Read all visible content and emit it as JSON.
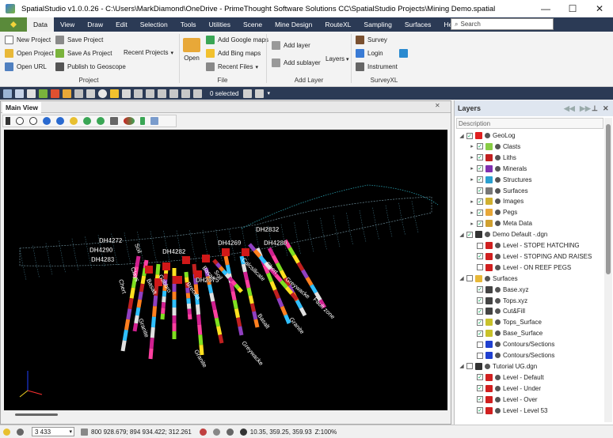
{
  "window": {
    "title": "SpatialStudio v1.0.0.26 - C:\\Users\\MarkDiamond\\OneDrive - PrimeThought Software Solutions CC\\SpatialStudio Projects\\Mining Demo.spatial",
    "minimize": "—",
    "maximize": "☐",
    "close": "✕"
  },
  "menu": {
    "items": [
      "Data",
      "View",
      "Draw",
      "Edit",
      "Selection",
      "Tools",
      "Utilities",
      "Scene",
      "Mine Design",
      "RouteXL",
      "Sampling",
      "Surfaces",
      "Help"
    ],
    "search_placeholder": "Search"
  },
  "ribbon": {
    "new_project": "New Project",
    "open_project": "Open Project",
    "open_url": "Open URL",
    "save_project": "Save Project",
    "save_as_project": "Save As Project",
    "publish_geoscope": "Publish to Geoscope",
    "recent_projects": "Recent Projects",
    "project_group": "Project",
    "open": "Open",
    "add_google_maps": "Add Google maps",
    "add_bing_maps": "Add Bing maps",
    "recent_files": "Recent Files",
    "file_group": "File",
    "add_layer": "Add layer",
    "add_sublayer": "Add sublayer",
    "layers": "Layers",
    "add_layer_group": "Add Layer",
    "survey": "Survey",
    "login": "Login",
    "instrument": "Instrument",
    "surveyxl_group": "SurveyXL"
  },
  "toolbar": {
    "selected": "0 selected"
  },
  "main_view": {
    "tab": "Main View",
    "drillhole_labels": [
      "DH4272",
      "DH4290",
      "DH4283",
      "DH4282",
      "DH4269",
      "DH4280",
      "DH2832",
      "DH2675"
    ],
    "lith_labels": [
      "Soil",
      "Clays",
      "Basalt",
      "Gabbro",
      "Chert",
      "Granite",
      "Breccia",
      "Basalt",
      "Soil",
      "Calcsilicate",
      "Greywacke",
      "Fault zone",
      "Granite",
      "Chert",
      "Basalt",
      "Greywacke",
      "Granite"
    ]
  },
  "layers": {
    "title": "Layers",
    "description_header": "Description",
    "rows": [
      {
        "label": "GeoLog",
        "level": 0,
        "checked": true,
        "expander": "◢",
        "color": "#e02020"
      },
      {
        "label": "Clasts",
        "level": 1,
        "checked": true,
        "expander": "▸",
        "color": "#88cc44"
      },
      {
        "label": "Liths",
        "level": 1,
        "checked": true,
        "expander": "▸",
        "color": "#c02020"
      },
      {
        "label": "Minerals",
        "level": 1,
        "checked": true,
        "expander": "▸",
        "color": "#8030b0"
      },
      {
        "label": "Structures",
        "level": 1,
        "checked": true,
        "expander": "▸",
        "color": "#2aa0d0"
      },
      {
        "label": "Surfaces",
        "level": 1,
        "checked": true,
        "expander": "",
        "color": "#777777"
      },
      {
        "label": "Images",
        "level": 1,
        "checked": true,
        "expander": "▸",
        "color": "#d0b030"
      },
      {
        "label": "Pegs",
        "level": 1,
        "checked": true,
        "expander": "▸",
        "color": "#e8a838"
      },
      {
        "label": "Meta Data",
        "level": 1,
        "checked": true,
        "expander": "▸",
        "color": "#d0a030"
      },
      {
        "label": "Demo  Default -.dgn",
        "level": 0,
        "checked": true,
        "expander": "◢",
        "color": "#333333"
      },
      {
        "label": "Level - STOPE HATCHING",
        "level": 1,
        "checked": false,
        "expander": "",
        "color": "#d02020"
      },
      {
        "label": "Level - STOPING AND RAISES",
        "level": 1,
        "checked": true,
        "expander": "",
        "color": "#d02020"
      },
      {
        "label": "Level - ON REEF PEGS",
        "level": 1,
        "checked": false,
        "expander": "",
        "color": "#d02020"
      },
      {
        "label": "Surfaces",
        "level": 0,
        "checked": false,
        "expander": "◢",
        "color": "#e8b838"
      },
      {
        "label": "Base.xyz",
        "level": 1,
        "checked": true,
        "expander": "",
        "color": "#444444"
      },
      {
        "label": "Tops.xyz",
        "level": 1,
        "checked": true,
        "expander": "",
        "color": "#444444"
      },
      {
        "label": "Cut&Fill",
        "level": 1,
        "checked": true,
        "expander": "",
        "color": "#444444"
      },
      {
        "label": "Tops_Surface",
        "level": 1,
        "checked": true,
        "expander": "",
        "color": "#c9c22a"
      },
      {
        "label": "Base_Surface",
        "level": 1,
        "checked": true,
        "expander": "",
        "color": "#c9c22a"
      },
      {
        "label": "Contours/Sections",
        "level": 1,
        "checked": false,
        "expander": "",
        "color": "#2040d0"
      },
      {
        "label": "Contours/Sections",
        "level": 1,
        "checked": false,
        "expander": "",
        "color": "#2040d0"
      },
      {
        "label": "Tutorial UG.dgn",
        "level": 0,
        "checked": false,
        "expander": "◢",
        "color": "#333333"
      },
      {
        "label": "Level - Default",
        "level": 1,
        "checked": true,
        "expander": "",
        "color": "#d02020"
      },
      {
        "label": "Level - Under",
        "level": 1,
        "checked": true,
        "expander": "",
        "color": "#d02020"
      },
      {
        "label": "Level - Over",
        "level": 1,
        "checked": true,
        "expander": "",
        "color": "#d02020"
      },
      {
        "label": "Level - Level 53",
        "level": 1,
        "checked": true,
        "expander": "",
        "color": "#d02020"
      }
    ]
  },
  "status": {
    "scale": "3 433",
    "coordinates": "800 928.679; 894 934.422; 312.261",
    "camera": "10.35, 359.25, 359.93",
    "zoom": "Z:100%"
  },
  "colors": {
    "menubar": "#2b3a55",
    "accent": "#5a8a3a"
  }
}
